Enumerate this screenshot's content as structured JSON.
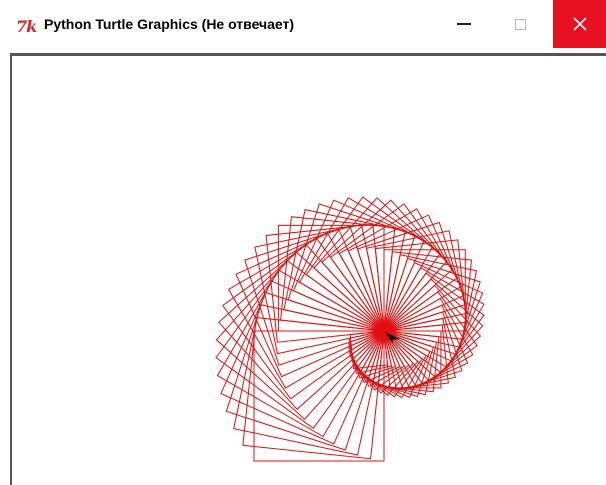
{
  "window": {
    "icon_text": "7k",
    "title": "Python Turtle Graphics (Не отвечает)"
  },
  "controls": {
    "minimize": "minimize",
    "maximize": "maximize",
    "close": "close"
  },
  "drawing": {
    "pen_color": "#e01010",
    "turtle_color": "#111111",
    "shape": "rotating-square-spiral",
    "square_count": 60,
    "rotation_per_square_deg": 1.5
  },
  "colors": {
    "close_bg": "#e81123",
    "canvas_bg": "#ffffff",
    "icon_color": "#d9262a"
  }
}
